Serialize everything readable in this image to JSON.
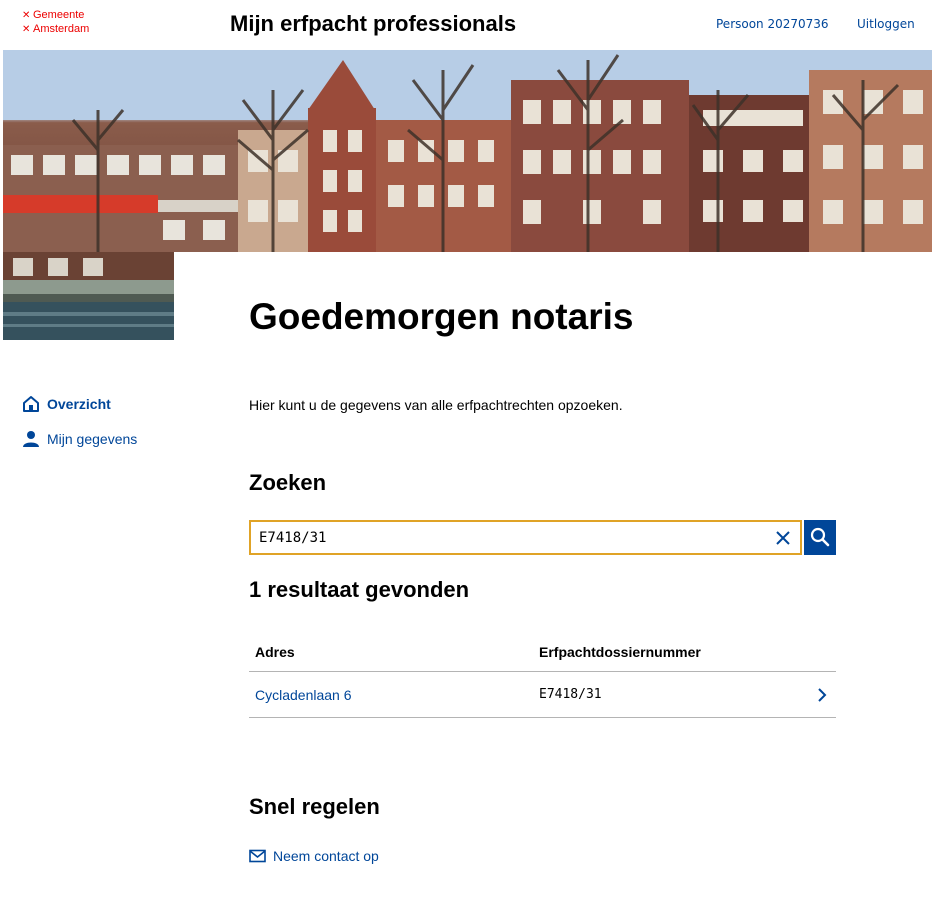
{
  "header": {
    "logo_line1": "Gemeente",
    "logo_line2": "Amsterdam",
    "app_title": "Mijn erfpacht professionals",
    "user_label": "Persoon 20270736",
    "logout_label": "Uitloggen"
  },
  "nav": {
    "items": [
      {
        "label": "Overzicht",
        "icon": "home-icon",
        "active": true
      },
      {
        "label": "Mijn gegevens",
        "icon": "person-icon",
        "active": false
      }
    ]
  },
  "main": {
    "greeting": "Goedemorgen notaris",
    "intro": "Hier kunt u de gegevens van alle erfpachtrechten opzoeken."
  },
  "search": {
    "heading": "Zoeken",
    "value": "E7418/31",
    "clear_icon": "close-icon",
    "submit_icon": "search-icon",
    "focus_color": "#e0a326"
  },
  "results": {
    "heading": "1 resultaat gevonden",
    "columns": [
      "Adres",
      "Erfpachtdossiernummer"
    ],
    "rows": [
      {
        "adres": "Cycladenlaan 6",
        "dossier": "E7418/31"
      }
    ]
  },
  "quick": {
    "heading": "Snel regelen",
    "contact_label": "Neem contact op"
  },
  "colors": {
    "brand_red": "#ec0000",
    "link_blue": "#004699"
  }
}
